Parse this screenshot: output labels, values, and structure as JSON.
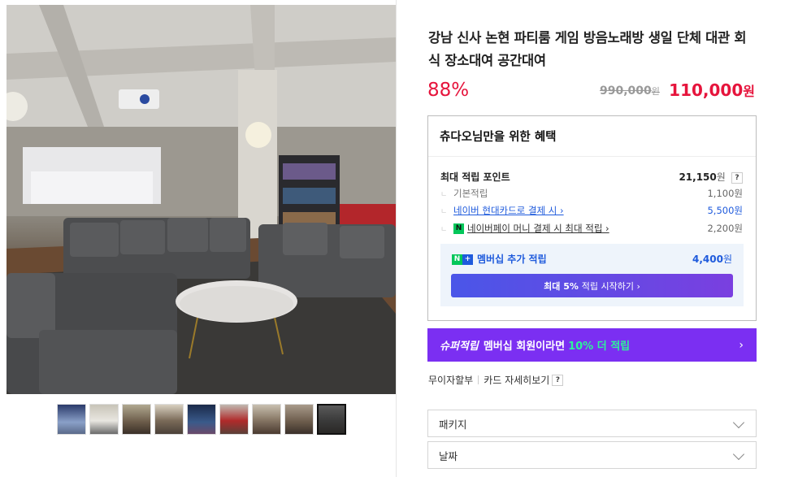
{
  "product": {
    "title": "강남 신사 논현 파티룸 게임 방음노래방 생일 단체 대관 회식 장소대여 공간대여",
    "discount": "88%",
    "original_price": "990,000",
    "original_price_unit": "원",
    "sale_price": "110,000",
    "sale_price_unit": "원"
  },
  "benefits": {
    "heading": "츄다오님만을 위한 혜택",
    "max_points_label": "최대 적립 포인트",
    "max_points_value": "21,150",
    "max_points_unit": "원",
    "help": "?",
    "rows": [
      {
        "label": "기본적립",
        "value": "1,100원"
      },
      {
        "label": "네이버 현대카드로 결제 시 ›",
        "value": "5,500원"
      },
      {
        "label": "네이버페이 머니 결제 시 최대 적립 ›",
        "value": "2,200원"
      }
    ],
    "npay_badge": "N",
    "member_label": "멤버십 추가 적립",
    "member_value": "4,400",
    "member_unit": "원",
    "start_button_prefix": "최대 5%",
    "start_button_suffix": "적립 시작하기 ›"
  },
  "super_banner": {
    "italic": "슈퍼적립",
    "text": "멤버십 회원이라면",
    "highlight": "10% 더 적립",
    "arrow": "›"
  },
  "card_links": {
    "installment": "무이자할부",
    "card_detail": "카드 자세히보기",
    "help": "?"
  },
  "options": {
    "package_label": "패키지",
    "date_label": "날짜"
  },
  "gallery": {
    "thumb_count": 9,
    "active_index": 8
  },
  "colors": {
    "accent_red": "#e6143c",
    "link_blue": "#1e5adc",
    "naver_green": "#03c75a",
    "banner_purple": "#7b2ff2",
    "banner_green": "#2ef29a"
  }
}
